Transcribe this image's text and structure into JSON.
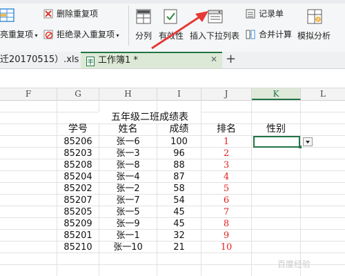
{
  "ribbon": {
    "dup_highlight_label": "亮重复项",
    "delete_dup_label": "删除重复项",
    "reject_dup_label": "拒绝录入重复项",
    "split_label": "分列",
    "validity_label": "有效性",
    "insert_dropdown_label": "插入下拉列表",
    "record_label": "记录单",
    "merge_calc_label": "合并计算",
    "simulate_label": "模拟分析"
  },
  "tabs": [
    {
      "label": "迁20170515）.xls"
    },
    {
      "label": "工作簿1 *"
    }
  ],
  "columns": [
    "F",
    "G",
    "H",
    "I",
    "J",
    "K",
    "L"
  ],
  "sheet": {
    "title": "五年级二班成绩表",
    "headers": {
      "id": "学号",
      "name": "姓名",
      "score": "成绩",
      "rank": "排名",
      "gender": "性别"
    },
    "rows": [
      {
        "id": "85206",
        "name": "张一6",
        "score": "100",
        "rank": "1"
      },
      {
        "id": "85203",
        "name": "张一3",
        "score": "96",
        "rank": "2"
      },
      {
        "id": "85208",
        "name": "张一8",
        "score": "88",
        "rank": "3"
      },
      {
        "id": "85204",
        "name": "张一4",
        "score": "87",
        "rank": "4"
      },
      {
        "id": "85202",
        "name": "张一2",
        "score": "58",
        "rank": "5"
      },
      {
        "id": "85207",
        "name": "张一7",
        "score": "54",
        "rank": "6"
      },
      {
        "id": "85205",
        "name": "张一5",
        "score": "45",
        "rank": "7"
      },
      {
        "id": "85209",
        "name": "张一9",
        "score": "45",
        "rank": "8"
      },
      {
        "id": "85201",
        "name": "张一1",
        "score": "32",
        "rank": "9"
      },
      {
        "id": "85210",
        "name": "张一10",
        "score": "21",
        "rank": "10"
      }
    ]
  },
  "colors": {
    "accent_green": "#217346",
    "rank_red": "#e0201e",
    "arrow_red": "#e53935"
  },
  "watermark": "百度经验"
}
